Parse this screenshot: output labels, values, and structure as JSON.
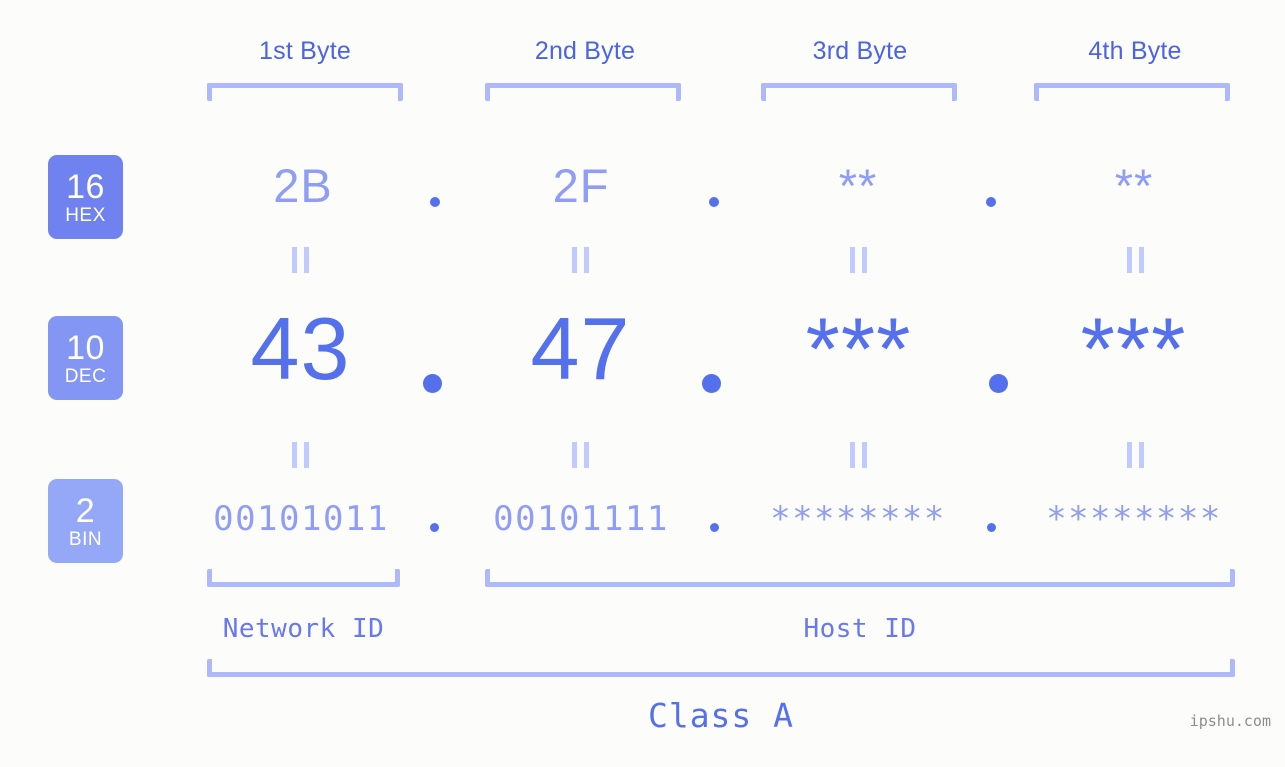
{
  "page": {
    "background_color": "#fcfdfa",
    "accent_color": "#5570ec",
    "accent_light_color": "#8f9df5",
    "bracket_color": "#aeb9fb"
  },
  "byte_headers": [
    {
      "label": "1st Byte"
    },
    {
      "label": "2nd Byte"
    },
    {
      "label": "3rd Byte"
    },
    {
      "label": "4th Byte"
    }
  ],
  "bases": [
    {
      "number": "16",
      "name": "HEX",
      "color": "#6f82ef"
    },
    {
      "number": "10",
      "name": "DEC",
      "color": "#8496f3"
    },
    {
      "number": "2",
      "name": "BIN",
      "color": "#95a7f7"
    }
  ],
  "rows": {
    "hex": {
      "base_number": "16",
      "base_name": "HEX",
      "values": [
        "2B",
        "2F",
        "**",
        "**"
      ],
      "separator": "."
    },
    "dec": {
      "base_number": "10",
      "base_name": "DEC",
      "values": [
        "43",
        "47",
        "***",
        "***"
      ],
      "separator": "."
    },
    "bin": {
      "base_number": "2",
      "base_name": "BIN",
      "values": [
        "00101011",
        "00101111",
        "********",
        "********"
      ],
      "separator": "."
    }
  },
  "equality_symbol": "||",
  "sections": {
    "network_id": "Network ID",
    "host_id": "Host ID",
    "class": "Class A"
  },
  "watermark": "ipshu.com"
}
